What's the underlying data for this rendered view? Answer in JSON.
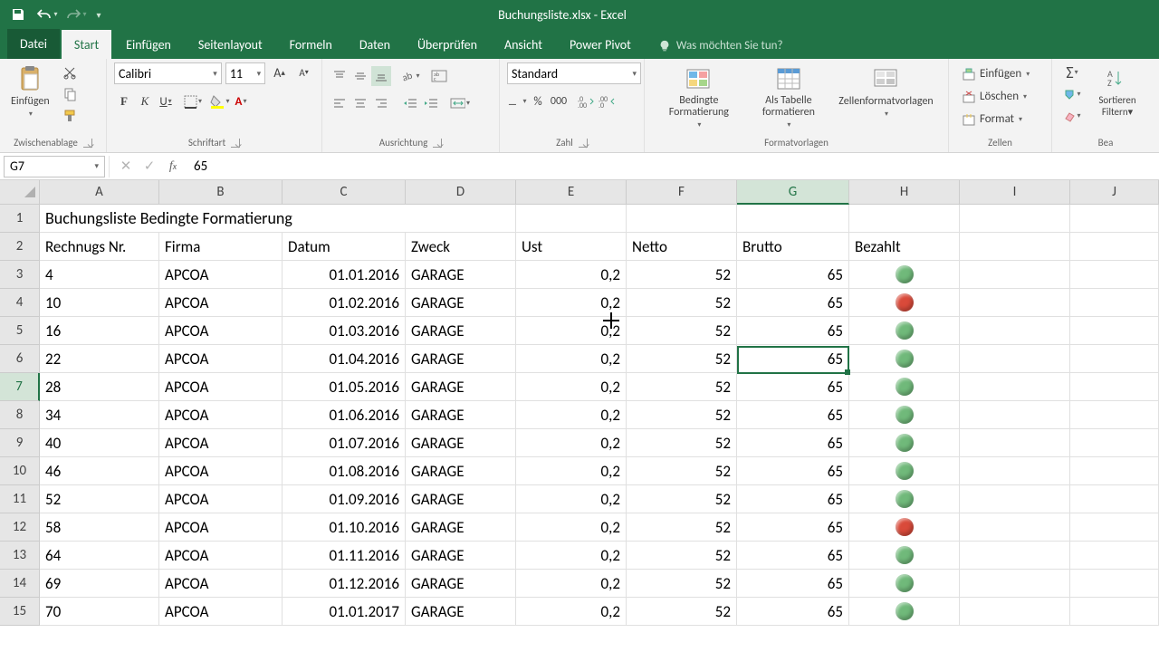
{
  "titlebar": {
    "title": "Buchungsliste.xlsx - Excel"
  },
  "tabs": {
    "file": "Datei",
    "home": "Start",
    "insert": "Einfügen",
    "layout": "Seitenlayout",
    "formulas": "Formeln",
    "data": "Daten",
    "review": "Überprüfen",
    "view": "Ansicht",
    "powerpivot": "Power Pivot",
    "tell": "Was möchten Sie tun?"
  },
  "ribbon": {
    "clipboard": {
      "label": "Zwischenablage",
      "paste": "Einfügen"
    },
    "font": {
      "label": "Schriftart",
      "name": "Calibri",
      "size": "11"
    },
    "alignment": {
      "label": "Ausrichtung"
    },
    "number": {
      "label": "Zahl",
      "format": "Standard"
    },
    "styles": {
      "label": "Formatvorlagen",
      "condfmt": "Bedingte Formatierung",
      "table": "Als Tabelle formatieren",
      "cellstyles": "Zellenformatvorlagen"
    },
    "cells": {
      "label": "Zellen",
      "insert": "Einfügen",
      "delete": "Löschen",
      "format": "Format"
    },
    "editing": {
      "label": "Bea",
      "sort": "Sortieren Filtern"
    }
  },
  "namebox": "G7",
  "formula": "65",
  "columns": [
    "A",
    "B",
    "C",
    "D",
    "E",
    "F",
    "G",
    "H",
    "I",
    "J"
  ],
  "title_row": "Buchungsliste Bedingte Formatierung",
  "headers": [
    "Rechnugs Nr.",
    "Firma",
    "Datum",
    "Zweck",
    "Ust",
    "Netto",
    "Brutto",
    "Bezahlt"
  ],
  "rows": [
    {
      "n": 3,
      "nr": "4",
      "firma": "APCOA",
      "datum": "01.01.2016",
      "zweck": "GARAGE",
      "ust": "0,2",
      "netto": "52",
      "brutto": "65",
      "paid": "green"
    },
    {
      "n": 4,
      "nr": "10",
      "firma": "APCOA",
      "datum": "01.02.2016",
      "zweck": "GARAGE",
      "ust": "0,2",
      "netto": "52",
      "brutto": "65",
      "paid": "red"
    },
    {
      "n": 5,
      "nr": "16",
      "firma": "APCOA",
      "datum": "01.03.2016",
      "zweck": "GARAGE",
      "ust": "0,2",
      "netto": "52",
      "brutto": "65",
      "paid": "green"
    },
    {
      "n": 6,
      "nr": "22",
      "firma": "APCOA",
      "datum": "01.04.2016",
      "zweck": "GARAGE",
      "ust": "0,2",
      "netto": "52",
      "brutto": "65",
      "paid": "green"
    },
    {
      "n": 7,
      "nr": "28",
      "firma": "APCOA",
      "datum": "01.05.2016",
      "zweck": "GARAGE",
      "ust": "0,2",
      "netto": "52",
      "brutto": "65",
      "paid": "green"
    },
    {
      "n": 8,
      "nr": "34",
      "firma": "APCOA",
      "datum": "01.06.2016",
      "zweck": "GARAGE",
      "ust": "0,2",
      "netto": "52",
      "brutto": "65",
      "paid": "green"
    },
    {
      "n": 9,
      "nr": "40",
      "firma": "APCOA",
      "datum": "01.07.2016",
      "zweck": "GARAGE",
      "ust": "0,2",
      "netto": "52",
      "brutto": "65",
      "paid": "green"
    },
    {
      "n": 10,
      "nr": "46",
      "firma": "APCOA",
      "datum": "01.08.2016",
      "zweck": "GARAGE",
      "ust": "0,2",
      "netto": "52",
      "brutto": "65",
      "paid": "green"
    },
    {
      "n": 11,
      "nr": "52",
      "firma": "APCOA",
      "datum": "01.09.2016",
      "zweck": "GARAGE",
      "ust": "0,2",
      "netto": "52",
      "brutto": "65",
      "paid": "green"
    },
    {
      "n": 12,
      "nr": "58",
      "firma": "APCOA",
      "datum": "01.10.2016",
      "zweck": "GARAGE",
      "ust": "0,2",
      "netto": "52",
      "brutto": "65",
      "paid": "red"
    },
    {
      "n": 13,
      "nr": "64",
      "firma": "APCOA",
      "datum": "01.11.2016",
      "zweck": "GARAGE",
      "ust": "0,2",
      "netto": "52",
      "brutto": "65",
      "paid": "green"
    },
    {
      "n": 14,
      "nr": "69",
      "firma": "APCOA",
      "datum": "01.12.2016",
      "zweck": "GARAGE",
      "ust": "0,2",
      "netto": "52",
      "brutto": "65",
      "paid": "green"
    },
    {
      "n": 15,
      "nr": "70",
      "firma": "APCOA",
      "datum": "01.01.2017",
      "zweck": "GARAGE",
      "ust": "0,2",
      "netto": "52",
      "brutto": "65",
      "paid": "green"
    }
  ],
  "selected": {
    "row": 7,
    "col": "G"
  }
}
